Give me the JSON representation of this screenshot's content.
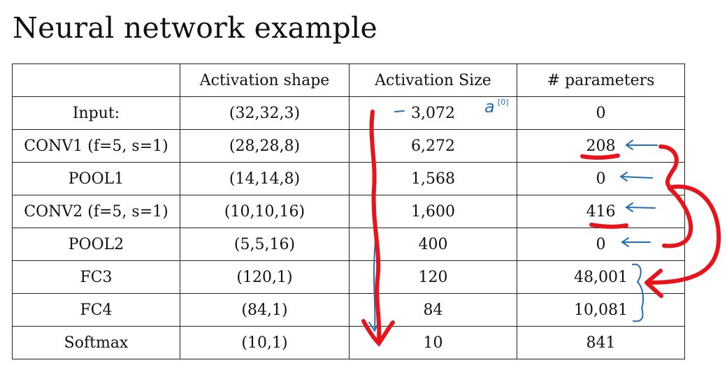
{
  "title": "Neural network example",
  "table": {
    "headers": [
      "",
      "Activation shape",
      "Activation Size",
      "# parameters"
    ],
    "rows": [
      {
        "layer": "Input:",
        "shape": "(32,32,3)",
        "size": "3,072",
        "params": "0"
      },
      {
        "layer": "CONV1 (f=5, s=1)",
        "shape": "(28,28,8)",
        "size": "6,272",
        "params": "208"
      },
      {
        "layer": "POOL1",
        "shape": "(14,14,8)",
        "size": "1,568",
        "params": "0"
      },
      {
        "layer": "CONV2  (f=5, s=1)",
        "shape": "(10,10,16)",
        "size": "1,600",
        "params": "416"
      },
      {
        "layer": "POOL2",
        "shape": "(5,5,16)",
        "size": "400",
        "params": "0"
      },
      {
        "layer": "FC3",
        "shape": "(120,1)",
        "size": "120",
        "params": "48,001"
      },
      {
        "layer": "FC4",
        "shape": "(84,1)",
        "size": "84",
        "params": "10,081"
      },
      {
        "layer": "Softmax",
        "shape": "(10,1)",
        "size": "10",
        "params": "841"
      }
    ]
  },
  "annotations": {
    "a0_label": "a",
    "a0_superscript": "[0]",
    "ink_red": "#e8141c",
    "ink_blue": "#1f6fb5"
  }
}
